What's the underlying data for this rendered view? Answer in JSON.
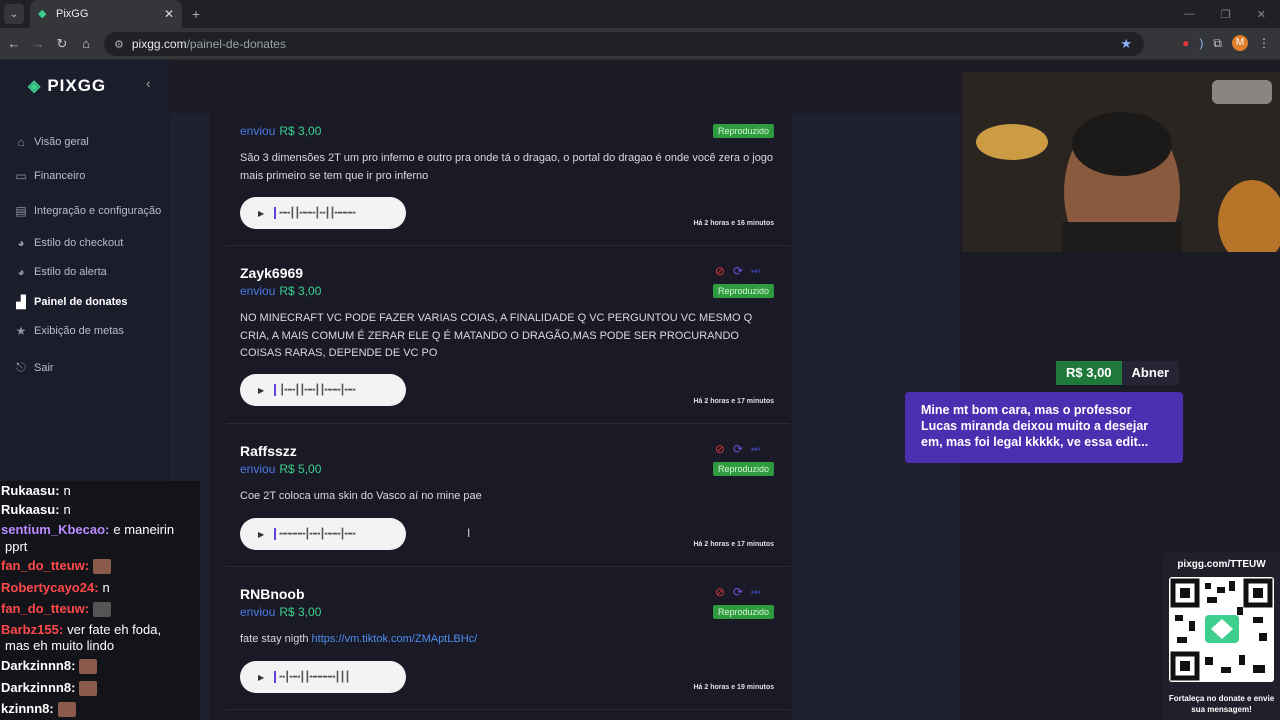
{
  "browser": {
    "tab_title": "PixGG",
    "url_host": "pixgg.com",
    "url_path": "/painel-de-donates",
    "avatar_letter": "M"
  },
  "sidebar": {
    "logo": "PIXGG",
    "items": [
      {
        "label": "Visão geral",
        "icon": "home-icon"
      },
      {
        "label": "Financeiro",
        "icon": "wallet-icon"
      },
      {
        "label": "Integração e configuração",
        "icon": "integration-icon"
      },
      {
        "label": "Estilo do checkout",
        "icon": "palette-icon"
      },
      {
        "label": "Estilo do alerta",
        "icon": "palette-icon"
      },
      {
        "label": "Painel de donates",
        "icon": "chart-icon"
      },
      {
        "label": "Exibição de metas",
        "icon": "star-icon"
      },
      {
        "label": "Sair",
        "icon": "logout-icon"
      }
    ]
  },
  "donations": [
    {
      "name": "",
      "sent_label": "enviou",
      "amount": "R$ 3,00",
      "status": "Reproduzido",
      "message": "São 3 dimensões 2T um pro inferno e outro pra onde tá o dragao, o portal do dragao é onde você zera o jogo mais primeiro se tem que ir pro inferno",
      "time": "Há 2 horas e 16 minutos"
    },
    {
      "name": "Zayk6969",
      "sent_label": "enviou",
      "amount": "R$ 3,00",
      "status": "Reproduzido",
      "message": "NO MINECRAFT VC PODE FAZER VARIAS COIAS, A FINALIDADE Q VC PERGUNTOU VC MESMO Q CRIA, A MAIS COMUM É ZERAR ELE Q É MATANDO O DRAGÃO,MAS PODE SER PROCURANDO COISAS RARAS, DEPENDE DE VC PO",
      "time": "Há 2 horas e 17 minutos"
    },
    {
      "name": "Raffsszz",
      "sent_label": "enviou",
      "amount": "R$ 5,00",
      "status": "Reproduzido",
      "message": "Coe 2T coloca uma skin do Vasco aí no mine pae",
      "time": "Há 2 horas e 17 minutos"
    },
    {
      "name": "RNBnoob",
      "sent_label": "enviou",
      "amount": "R$ 3,00",
      "status": "Reproduzido",
      "message": "fate stay nigth ",
      "link": "https://vm.tiktok.com/ZMAptLBHc/",
      "time": "Há 2 horas e 19 minutos"
    }
  ],
  "overlay": {
    "alert_amount": "R$ 3,00",
    "alert_name": "Abner",
    "alert_message": "Mine mt bom cara, mas o professor Lucas miranda deixou muito a desejar em, mas foi legal kkkkk, ve essa edit...",
    "qr_url": "pixgg.com/TTEUW",
    "qr_footer": "Fortaleça no donate e envie sua mensagem!"
  },
  "chat": [
    {
      "user": "Rukaasu:",
      "text": "n",
      "color": "#ffffff"
    },
    {
      "user": "Rukaasu:",
      "text": "n",
      "color": "#ffffff"
    },
    {
      "user": "sentium_Kbecao:",
      "text": "e maneirin",
      "color": "#b98cff"
    },
    {
      "user": "",
      "text": "pprt",
      "color": "#ffffff"
    },
    {
      "user": "fan_do_tteuw:",
      "text": "",
      "color": "#ff4a4a"
    },
    {
      "user": "Robertycayo24:",
      "text": "n",
      "color": "#ff4a4a"
    },
    {
      "user": "fan_do_tteuw:",
      "text": "",
      "color": "#ff4a4a"
    },
    {
      "user": "Barbz155:",
      "text": "ver fate eh foda,",
      "color": "#ff4a4a"
    },
    {
      "user": "",
      "text": "mas eh muito lindo",
      "color": "#ffffff"
    },
    {
      "user": "Darkzinnn8:",
      "text": "",
      "color": "#ffffff"
    },
    {
      "user": "Darkzinnn8:",
      "text": "",
      "color": "#ffffff"
    },
    {
      "user": "kzinnn8:",
      "text": "",
      "color": "#ffffff"
    }
  ]
}
